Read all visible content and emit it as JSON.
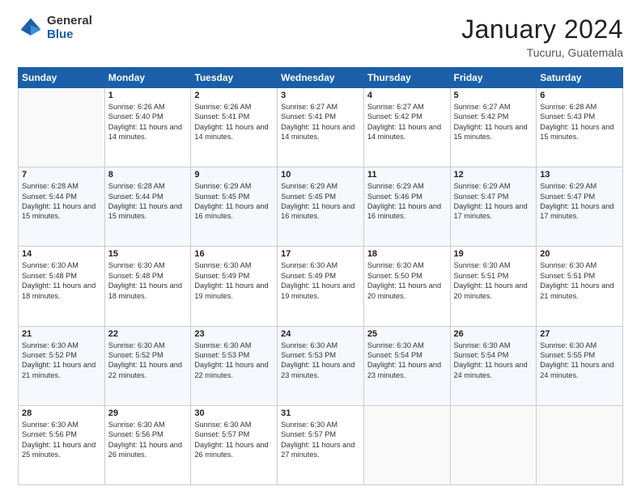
{
  "header": {
    "logo_general": "General",
    "logo_blue": "Blue",
    "month_year": "January 2024",
    "location": "Tucuru, Guatemala"
  },
  "calendar": {
    "days_of_week": [
      "Sunday",
      "Monday",
      "Tuesday",
      "Wednesday",
      "Thursday",
      "Friday",
      "Saturday"
    ],
    "weeks": [
      [
        {
          "day": "",
          "content": ""
        },
        {
          "day": "1",
          "content": "Sunrise: 6:26 AM\nSunset: 5:40 PM\nDaylight: 11 hours\nand 14 minutes."
        },
        {
          "day": "2",
          "content": "Sunrise: 6:26 AM\nSunset: 5:41 PM\nDaylight: 11 hours\nand 14 minutes."
        },
        {
          "day": "3",
          "content": "Sunrise: 6:27 AM\nSunset: 5:41 PM\nDaylight: 11 hours\nand 14 minutes."
        },
        {
          "day": "4",
          "content": "Sunrise: 6:27 AM\nSunset: 5:42 PM\nDaylight: 11 hours\nand 14 minutes."
        },
        {
          "day": "5",
          "content": "Sunrise: 6:27 AM\nSunset: 5:42 PM\nDaylight: 11 hours\nand 15 minutes."
        },
        {
          "day": "6",
          "content": "Sunrise: 6:28 AM\nSunset: 5:43 PM\nDaylight: 11 hours\nand 15 minutes."
        }
      ],
      [
        {
          "day": "7",
          "content": "Sunrise: 6:28 AM\nSunset: 5:44 PM\nDaylight: 11 hours\nand 15 minutes."
        },
        {
          "day": "8",
          "content": "Sunrise: 6:28 AM\nSunset: 5:44 PM\nDaylight: 11 hours\nand 15 minutes."
        },
        {
          "day": "9",
          "content": "Sunrise: 6:29 AM\nSunset: 5:45 PM\nDaylight: 11 hours\nand 16 minutes."
        },
        {
          "day": "10",
          "content": "Sunrise: 6:29 AM\nSunset: 5:45 PM\nDaylight: 11 hours\nand 16 minutes."
        },
        {
          "day": "11",
          "content": "Sunrise: 6:29 AM\nSunset: 5:46 PM\nDaylight: 11 hours\nand 16 minutes."
        },
        {
          "day": "12",
          "content": "Sunrise: 6:29 AM\nSunset: 5:47 PM\nDaylight: 11 hours\nand 17 minutes."
        },
        {
          "day": "13",
          "content": "Sunrise: 6:29 AM\nSunset: 5:47 PM\nDaylight: 11 hours\nand 17 minutes."
        }
      ],
      [
        {
          "day": "14",
          "content": "Sunrise: 6:30 AM\nSunset: 5:48 PM\nDaylight: 11 hours\nand 18 minutes."
        },
        {
          "day": "15",
          "content": "Sunrise: 6:30 AM\nSunset: 5:48 PM\nDaylight: 11 hours\nand 18 minutes."
        },
        {
          "day": "16",
          "content": "Sunrise: 6:30 AM\nSunset: 5:49 PM\nDaylight: 11 hours\nand 19 minutes."
        },
        {
          "day": "17",
          "content": "Sunrise: 6:30 AM\nSunset: 5:49 PM\nDaylight: 11 hours\nand 19 minutes."
        },
        {
          "day": "18",
          "content": "Sunrise: 6:30 AM\nSunset: 5:50 PM\nDaylight: 11 hours\nand 20 minutes."
        },
        {
          "day": "19",
          "content": "Sunrise: 6:30 AM\nSunset: 5:51 PM\nDaylight: 11 hours\nand 20 minutes."
        },
        {
          "day": "20",
          "content": "Sunrise: 6:30 AM\nSunset: 5:51 PM\nDaylight: 11 hours\nand 21 minutes."
        }
      ],
      [
        {
          "day": "21",
          "content": "Sunrise: 6:30 AM\nSunset: 5:52 PM\nDaylight: 11 hours\nand 21 minutes."
        },
        {
          "day": "22",
          "content": "Sunrise: 6:30 AM\nSunset: 5:52 PM\nDaylight: 11 hours\nand 22 minutes."
        },
        {
          "day": "23",
          "content": "Sunrise: 6:30 AM\nSunset: 5:53 PM\nDaylight: 11 hours\nand 22 minutes."
        },
        {
          "day": "24",
          "content": "Sunrise: 6:30 AM\nSunset: 5:53 PM\nDaylight: 11 hours\nand 23 minutes."
        },
        {
          "day": "25",
          "content": "Sunrise: 6:30 AM\nSunset: 5:54 PM\nDaylight: 11 hours\nand 23 minutes."
        },
        {
          "day": "26",
          "content": "Sunrise: 6:30 AM\nSunset: 5:54 PM\nDaylight: 11 hours\nand 24 minutes."
        },
        {
          "day": "27",
          "content": "Sunrise: 6:30 AM\nSunset: 5:55 PM\nDaylight: 11 hours\nand 24 minutes."
        }
      ],
      [
        {
          "day": "28",
          "content": "Sunrise: 6:30 AM\nSunset: 5:56 PM\nDaylight: 11 hours\nand 25 minutes."
        },
        {
          "day": "29",
          "content": "Sunrise: 6:30 AM\nSunset: 5:56 PM\nDaylight: 11 hours\nand 26 minutes."
        },
        {
          "day": "30",
          "content": "Sunrise: 6:30 AM\nSunset: 5:57 PM\nDaylight: 11 hours\nand 26 minutes."
        },
        {
          "day": "31",
          "content": "Sunrise: 6:30 AM\nSunset: 5:57 PM\nDaylight: 11 hours\nand 27 minutes."
        },
        {
          "day": "",
          "content": ""
        },
        {
          "day": "",
          "content": ""
        },
        {
          "day": "",
          "content": ""
        }
      ]
    ]
  }
}
